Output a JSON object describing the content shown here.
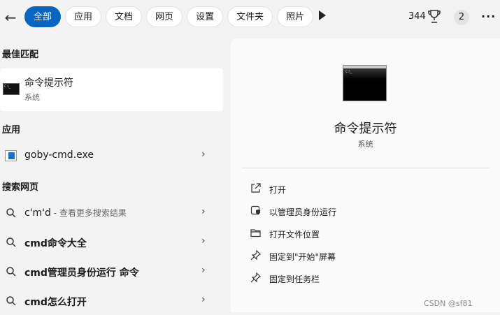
{
  "topbar": {
    "tabs": [
      {
        "label": "全部",
        "active": true
      },
      {
        "label": "应用"
      },
      {
        "label": "文档"
      },
      {
        "label": "网页"
      },
      {
        "label": "设置"
      },
      {
        "label": "文件夹"
      },
      {
        "label": "照片"
      }
    ],
    "points": "344",
    "notification_count": "2",
    "accent_color": "#0a64c2"
  },
  "left": {
    "best_match_heading": "最佳匹配",
    "best_match": {
      "title": "命令提示符",
      "subtitle": "系统"
    },
    "apps_heading": "应用",
    "app_item": {
      "label": "goby-cmd.exe"
    },
    "web_heading": "搜索网页",
    "web_items": [
      {
        "query": "c'm'd",
        "suffix": " - 查看更多搜索结果"
      },
      {
        "query": "cmd命令大全"
      },
      {
        "query": "cmd管理员身份运行 命令"
      },
      {
        "query": "cmd怎么打开"
      }
    ]
  },
  "right": {
    "title": "命令提示符",
    "subtitle": "系统",
    "actions": [
      {
        "label": "打开",
        "icon": "open-external-icon"
      },
      {
        "label": "以管理员身份运行",
        "icon": "admin-shield-icon"
      },
      {
        "label": "打开文件位置",
        "icon": "folder-icon"
      },
      {
        "label": "固定到\"开始\"屏幕",
        "icon": "pin-icon"
      },
      {
        "label": "固定到任务栏",
        "icon": "pin-icon"
      }
    ]
  },
  "watermark": "CSDN @sf81"
}
